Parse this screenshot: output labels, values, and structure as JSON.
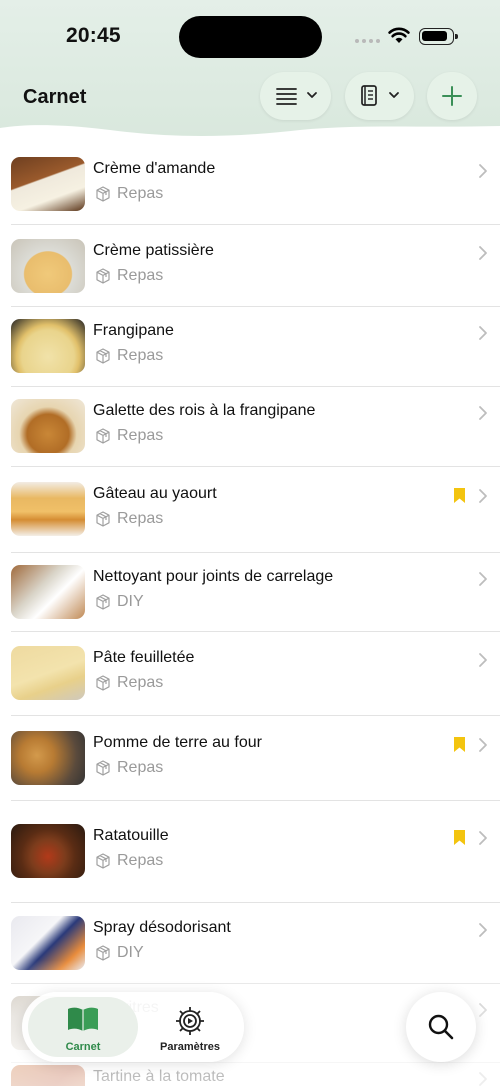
{
  "status_bar": {
    "time": "20:45"
  },
  "header": {
    "title": "Carnet"
  },
  "items": [
    {
      "title": "Crème d'amande",
      "category": "Repas",
      "bookmarked": false,
      "thumb": "almond-cream"
    },
    {
      "title": "Crème patissière",
      "category": "Repas",
      "bookmarked": false,
      "thumb": "pastry-cream"
    },
    {
      "title": "Frangipane",
      "category": "Repas",
      "bookmarked": false,
      "thumb": "frangipane"
    },
    {
      "title": "Galette des rois à la frangipane",
      "category": "Repas",
      "bookmarked": false,
      "thumb": "galette"
    },
    {
      "title": "Gâteau au yaourt",
      "category": "Repas",
      "bookmarked": true,
      "thumb": "yogurt-cake"
    },
    {
      "title": "Nettoyant pour joints de carrelage",
      "category": "DIY",
      "bookmarked": false,
      "thumb": "cleaner"
    },
    {
      "title": "Pâte feuilletée",
      "category": "Repas",
      "bookmarked": false,
      "thumb": "puff-pastry"
    },
    {
      "title": "Pomme de terre au four",
      "category": "Repas",
      "bookmarked": true,
      "thumb": "baked-potato"
    },
    {
      "title": "Ratatouille",
      "category": "Repas",
      "bookmarked": true,
      "thumb": "ratatouille"
    },
    {
      "title": "Spray désodorisant",
      "category": "DIY",
      "bookmarked": false,
      "thumb": "spray"
    },
    {
      "title": "our vitres",
      "category": "",
      "bookmarked": false,
      "thumb": "window"
    },
    {
      "title": "Tartine à la tomate",
      "category": "",
      "bookmarked": false,
      "thumb": "tartine"
    }
  ],
  "tabbar": {
    "tabs": [
      {
        "label": "Carnet",
        "icon": "book-icon",
        "active": true
      },
      {
        "label": "Paramètres",
        "icon": "gear-icon",
        "active": false
      }
    ]
  },
  "icons": {
    "category_icon": "cube-icon",
    "chevron": "chevron-right-icon",
    "bookmark": "bookmark-icon",
    "search": "search-icon"
  },
  "colors": {
    "accent": "#2f8a4a",
    "header_bg": "#e6f0ea",
    "bookmark": "#f3c40f",
    "secondary_text": "#9a9a9a"
  }
}
